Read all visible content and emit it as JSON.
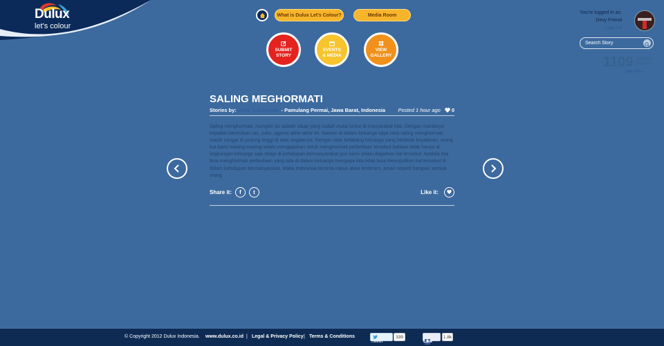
{
  "logo": {
    "brand": "Dulux",
    "tagline": "let's colour"
  },
  "nav": {
    "home_icon": "home-icon",
    "pills": [
      "What is Dulux Let's Colour?",
      "Media Room"
    ]
  },
  "actions": [
    {
      "label1": "SUBMIT",
      "label2": "STORY",
      "icon": "edit-icon",
      "color": "#e4231f"
    },
    {
      "label1": "EVENTS",
      "label2": "& MEDIA",
      "icon": "calendar-icon",
      "color": "#f7c42d"
    },
    {
      "label1": "VIEW",
      "label2": "GALLERY",
      "icon": "grid-icon",
      "color": "#f1901b"
    }
  ],
  "user": {
    "logged_in_text": "You're logged in as:",
    "name": "Devy Friend",
    "link": "Log out"
  },
  "search": {
    "placeholder": "Search Story"
  },
  "stats": {
    "count": "1109",
    "label1": "Stories",
    "label2": "Posted",
    "link": "See more"
  },
  "story": {
    "title": "SALING MEGHORMATI",
    "by_label": "Stories by:",
    "author": "Devy Sulistyawati",
    "location": "- Pamulang Permai, Jawa Barat, Indonesia",
    "posted": "Posted 1 hour ago",
    "likes": "0",
    "body": "Saling menghormati, mungkin itu adalah sikap yang sudah mulai luntur di masyarakat kita. Dengan maraknya kejadian bentrokan ras, suku, agama akhir-akhir ini. Namun di dalam keluarga saya rasa saling menghormati masih sangat di junjung tinggi di atas segalanya. Dengan latar belakang keluarga yang berbeda keyakinan, orang tua kami masing masing selalu mengajarkan untuk menghormati perbedaan tersebut bahkan tidak hanya di lingkungan keluarga saja tetapi di kehidupan bermasyarakat pun kami selalu diajarkan hal tersebut. Apabila kita bisa menghormati perbedaan yang ada di dalam keluarga mengapa kita tidak bisa mewujudkan hal tersebut di dalam kehidupan bermasyarakat. Maka Indonesia tercinta inipun akan tenteram, aman seperti harapan semua orang",
    "share_label": "Share it:",
    "like_label": "Like it:"
  },
  "footer": {
    "copyright": "© Copyright 2012 Dulux Indonesia.",
    "site": "www.dulux.co.id",
    "sep": "|",
    "legal": "Legal & Privacy Policy",
    "terms": "Terms & Conditions",
    "tweet": "Tweet",
    "tweet_count": "339",
    "like": "Like",
    "like_count": "1.8k"
  }
}
